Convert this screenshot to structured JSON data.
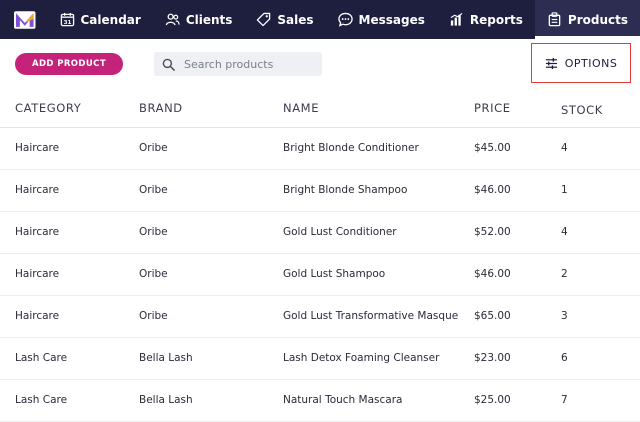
{
  "nav": {
    "items": [
      {
        "label": "Calendar",
        "icon": "calendar-icon"
      },
      {
        "label": "Clients",
        "icon": "clients-icon"
      },
      {
        "label": "Sales",
        "icon": "tag-icon"
      },
      {
        "label": "Messages",
        "icon": "chat-icon"
      },
      {
        "label": "Reports",
        "icon": "chart-icon"
      },
      {
        "label": "Products",
        "icon": "products-icon",
        "active": true
      }
    ],
    "calendar_day": "31"
  },
  "toolbar": {
    "add_label": "ADD PRODUCT",
    "search_placeholder": "Search products",
    "options_label": "OPTIONS"
  },
  "colors": {
    "nav_bg": "#1e1e3f",
    "accent": "#c5237a",
    "highlight_border": "#e53935"
  },
  "table": {
    "headers": [
      "CATEGORY",
      "BRAND",
      "NAME",
      "PRICE",
      "STOCK"
    ],
    "rows": [
      [
        "Haircare",
        "Oribe",
        "Bright Blonde Conditioner",
        "$45.00",
        "4"
      ],
      [
        "Haircare",
        "Oribe",
        "Bright Blonde Shampoo",
        "$46.00",
        "1"
      ],
      [
        "Haircare",
        "Oribe",
        "Gold Lust Conditioner",
        "$52.00",
        "4"
      ],
      [
        "Haircare",
        "Oribe",
        "Gold Lust Shampoo",
        "$46.00",
        "2"
      ],
      [
        "Haircare",
        "Oribe",
        "Gold Lust Transformative Masque",
        "$65.00",
        "3"
      ],
      [
        "Lash Care",
        "Bella Lash",
        "Lash Detox Foaming Cleanser",
        "$23.00",
        "6"
      ],
      [
        "Lash Care",
        "Bella Lash",
        "Natural Touch Mascara",
        "$25.00",
        "7"
      ]
    ]
  }
}
